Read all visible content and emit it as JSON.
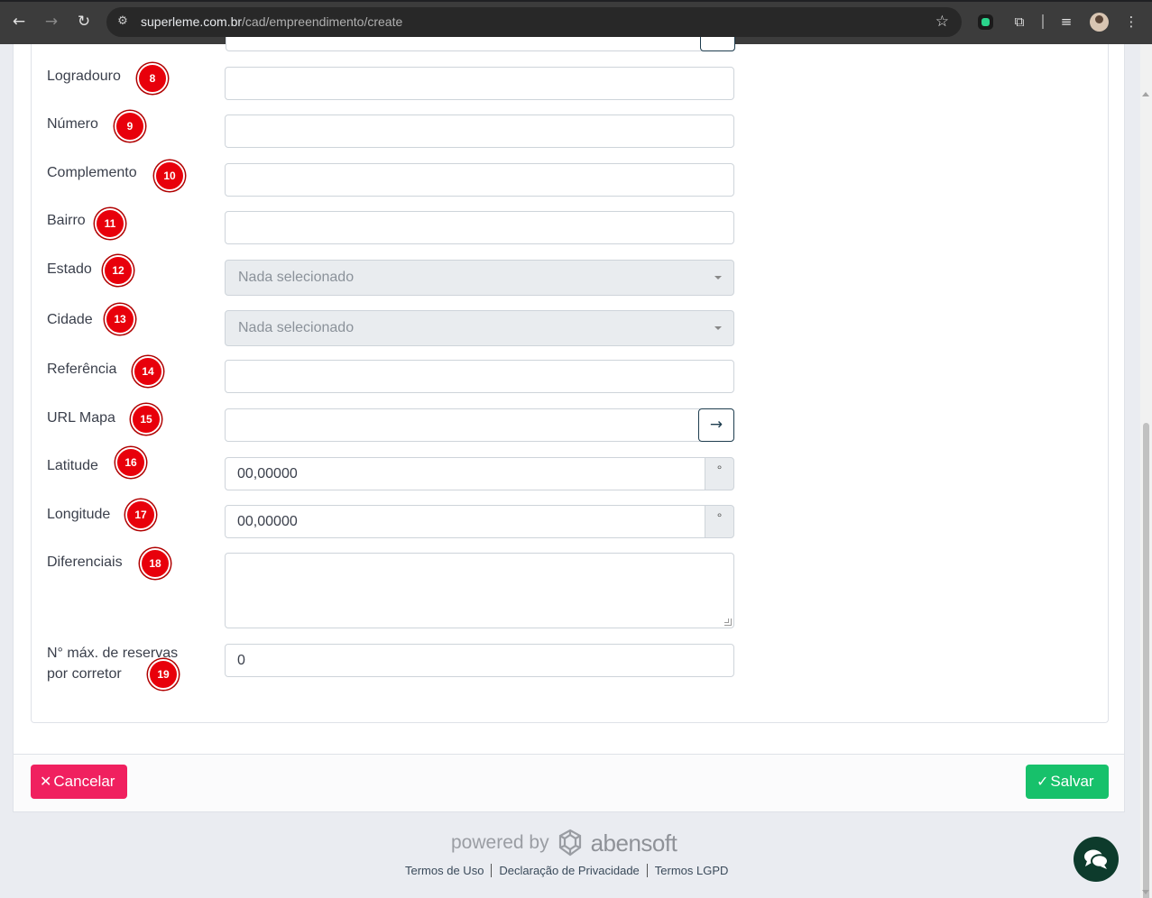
{
  "browser": {
    "url_domain": "superleme.com.br",
    "url_path": "/cad/empreendimento/create"
  },
  "form": {
    "fields": {
      "logradouro": {
        "label": "Logradouro",
        "badge": "8",
        "value": ""
      },
      "numero": {
        "label": "Número",
        "badge": "9",
        "value": ""
      },
      "complemento": {
        "label": "Complemento",
        "badge": "10",
        "value": ""
      },
      "bairro": {
        "label": "Bairro",
        "badge": "11",
        "value": ""
      },
      "estado": {
        "label": "Estado",
        "badge": "12",
        "selected": "Nada selecionado"
      },
      "cidade": {
        "label": "Cidade",
        "badge": "13",
        "selected": "Nada selecionado"
      },
      "referencia": {
        "label": "Referência",
        "badge": "14",
        "value": ""
      },
      "url_mapa": {
        "label": "URL Mapa",
        "badge": "15",
        "value": "",
        "button_symbol": "→"
      },
      "latitude": {
        "label": "Latitude",
        "badge": "16",
        "value": "00,00000",
        "unit": "°"
      },
      "longitude": {
        "label": "Longitude",
        "badge": "17",
        "value": "00,00000",
        "unit": "°"
      },
      "diferenciais": {
        "label": "Diferenciais",
        "badge": "18",
        "value": ""
      },
      "max_reservas": {
        "label_line1": "N° máx. de reservas",
        "label_line2": "por corretor",
        "badge": "19",
        "value": "0"
      }
    }
  },
  "actions": {
    "cancel_label": "Cancelar",
    "save_label": "Salvar"
  },
  "footer": {
    "powered_by": "powered by",
    "brand": "abensoft",
    "links": [
      "Termos de Uso",
      "Declaração de Privacidade",
      "Termos LGPD"
    ]
  },
  "colors": {
    "badge": "#e8000b",
    "cancel": "#f0205f",
    "save": "#17c16b",
    "chat": "#0d3b2c"
  }
}
